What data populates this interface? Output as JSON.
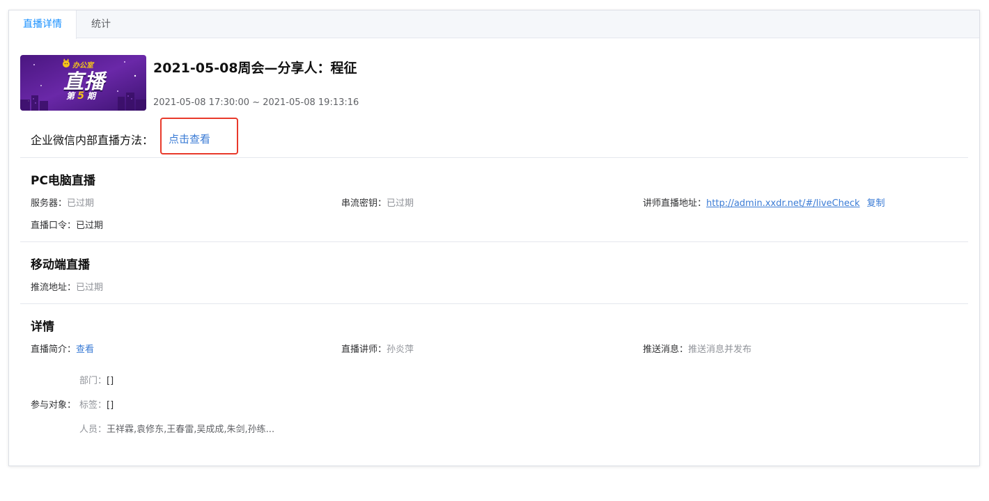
{
  "tabs": [
    {
      "label": "直播详情",
      "active": true
    },
    {
      "label": "统计",
      "active": false
    }
  ],
  "cover": {
    "brand": "办公室",
    "main_text": "直播",
    "issue_prefix": "第",
    "issue_number": "5",
    "issue_suffix": "期",
    "bg_color": "#5b1f93",
    "accent_color": "#f5c518"
  },
  "live": {
    "title": "2021-05-08周会—分享人：程征",
    "time_range": "2021-05-08 17:30:00 ~ 2021-05-08 19:13:16"
  },
  "method": {
    "label": "企业微信内部直播方法：",
    "link_text": "点击查看"
  },
  "pc": {
    "section_title": "PC电脑直播",
    "server_label": "服务器：",
    "server_value": "已过期",
    "key_label": "串流密钥：",
    "key_value": "已过期",
    "lecturer_url_label": "讲师直播地址：",
    "lecturer_url": "http://admin.xxdr.net/#/liveCheck",
    "copy_label": "复制",
    "password_label": "直播口令：",
    "password_value": "已过期"
  },
  "mobile": {
    "section_title": "移动端直播",
    "push_label": "推流地址：",
    "push_value": "已过期"
  },
  "details": {
    "section_title": "详情",
    "intro_label": "直播简介：",
    "intro_link": "查看",
    "lecturer_label": "直播讲师：",
    "lecturer_value": "孙炎萍",
    "push_msg_label": "推送消息：",
    "push_msg_value": "推送消息并发布",
    "participants_label": "参与对象：",
    "dept_label": "部门：",
    "dept_value": "[]",
    "tag_label": "标签：",
    "tag_value": "[]",
    "people_label": "人员：",
    "people_value": "王祥霖,袁修东,王春雷,吴成成,朱剑,孙练..."
  }
}
